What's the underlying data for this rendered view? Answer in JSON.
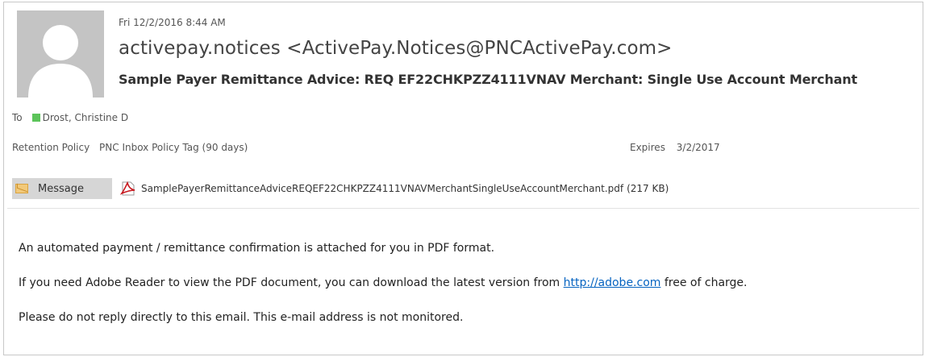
{
  "header": {
    "date": "Fri 12/2/2016 8:44 AM",
    "sender": "activepay.notices <ActivePay.Notices@PNCActivePay.com>",
    "subject": "Sample Payer Remittance Advice:  REQ EF22CHKPZZ4111VNAV Merchant: Single Use Account Merchant",
    "avatar_icon": "default-person-icon",
    "to_label": "To",
    "to_recipient": "Drost, Christine D",
    "presence_color": "#5cc45a",
    "retention_label": "Retention Policy",
    "retention_value": "PNC Inbox Policy Tag (90 days)",
    "expires_label": "Expires",
    "expires_value": "3/2/2017"
  },
  "attachments": {
    "message_label": "Message",
    "message_icon": "envelope-icon",
    "file_icon": "pdf-icon",
    "file_name": "SamplePayerRemittanceAdviceREQEF22CHKPZZ4111VNAVMerchantSingleUseAccountMerchant.pdf",
    "file_size": "(217 KB)"
  },
  "body": {
    "line1": "An automated payment / remittance confirmation is attached for you in PDF format.",
    "line2_before": "If you need Adobe Reader to view the PDF document, you can download the latest version from",
    "line2_link": "http://adobe.com",
    "line2_after": "free of charge.",
    "line3": "Please do not reply directly to this email. This e-mail address is not monitored.",
    "link_color": "#0563c1"
  }
}
